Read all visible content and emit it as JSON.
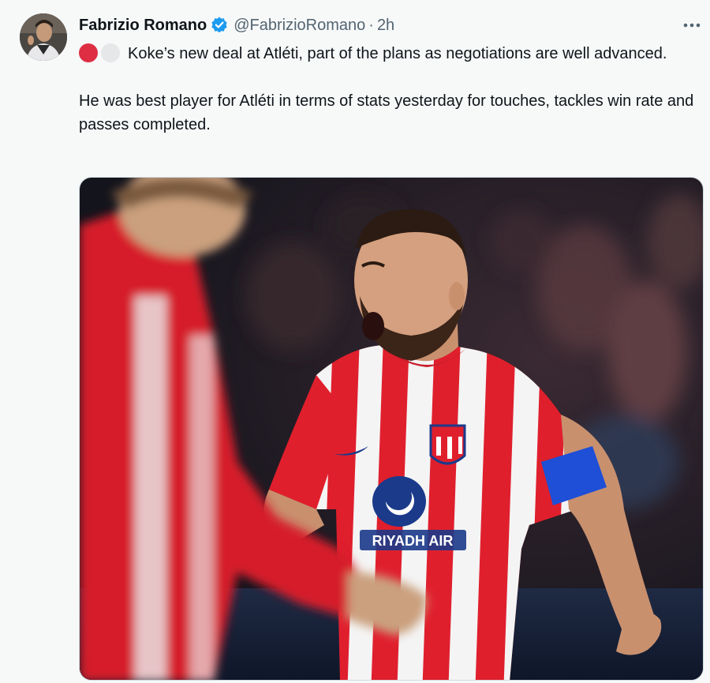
{
  "tweet": {
    "author_name": "Fabrizio Romano",
    "handle": "@FabrizioRomano",
    "separator": "·",
    "time": "2h",
    "text_line1": "Koke’s new deal at Atléti, part of the plans as negotiations are well advanced.",
    "text_line2": "He was best player for Atléti in terms of stats yesterday for touches, tackles win rate and passes completed."
  },
  "icons": {
    "verified": "verified-badge-icon",
    "more": "more-options-icon",
    "emoji_1": "red-circle-emoji",
    "emoji_2": "white-circle-emoji"
  },
  "photo": {
    "sponsor_text": "RIYADH AIR",
    "caption_semantic": "Koke shouting on the pitch in an Atlético Madrid jersey"
  },
  "colors": {
    "verified_blue": "#1d9bf0",
    "text_primary": "#0f1419",
    "text_secondary": "#536471",
    "background": "#f7f9f9",
    "jersey_red": "#d9232e"
  }
}
